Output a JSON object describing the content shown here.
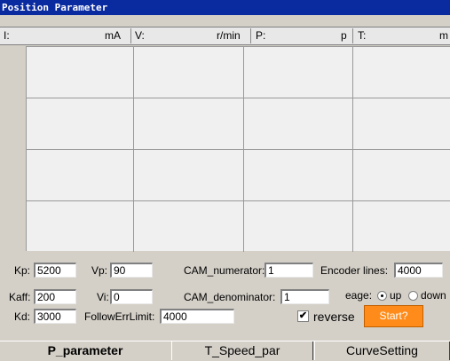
{
  "window": {
    "title": "Position Parameter"
  },
  "status": [
    {
      "label": "I:",
      "unit": "mA"
    },
    {
      "label": "V:",
      "unit": "r/min"
    },
    {
      "label": "P:",
      "unit": "p"
    },
    {
      "label": "T:",
      "unit": "m"
    }
  ],
  "params": {
    "kp": {
      "label": "Kp:",
      "value": "5200"
    },
    "vp": {
      "label": "Vp:",
      "value": "90"
    },
    "cam_num": {
      "label": "CAM_numerator:",
      "value": "1"
    },
    "encoder": {
      "label": "Encoder lines:",
      "value": "4000"
    },
    "kaff": {
      "label": "Kaff:",
      "value": "200"
    },
    "vi": {
      "label": "Vi:",
      "value": "0"
    },
    "cam_den": {
      "label": "CAM_denominator:",
      "value": "1"
    },
    "edge": {
      "label": "eage:",
      "option_up": "up",
      "option_down": "down",
      "selected": "up"
    },
    "kd": {
      "label": "Kd:",
      "value": "3000"
    },
    "follow": {
      "label": "FollowErrLimit:",
      "value": "4000"
    },
    "reverse": {
      "label": "reverse",
      "checked": true
    },
    "start": {
      "label": "Start?"
    }
  },
  "tabs": [
    {
      "label": "P_parameter",
      "active": true
    },
    {
      "label": "T_Speed_par",
      "active": false
    },
    {
      "label": "CurveSetting",
      "active": false
    }
  ],
  "colors": {
    "title_bg": "#0a2aa0",
    "start_button": "#ff8c1a",
    "grid_bg": "#f0f0f0"
  }
}
